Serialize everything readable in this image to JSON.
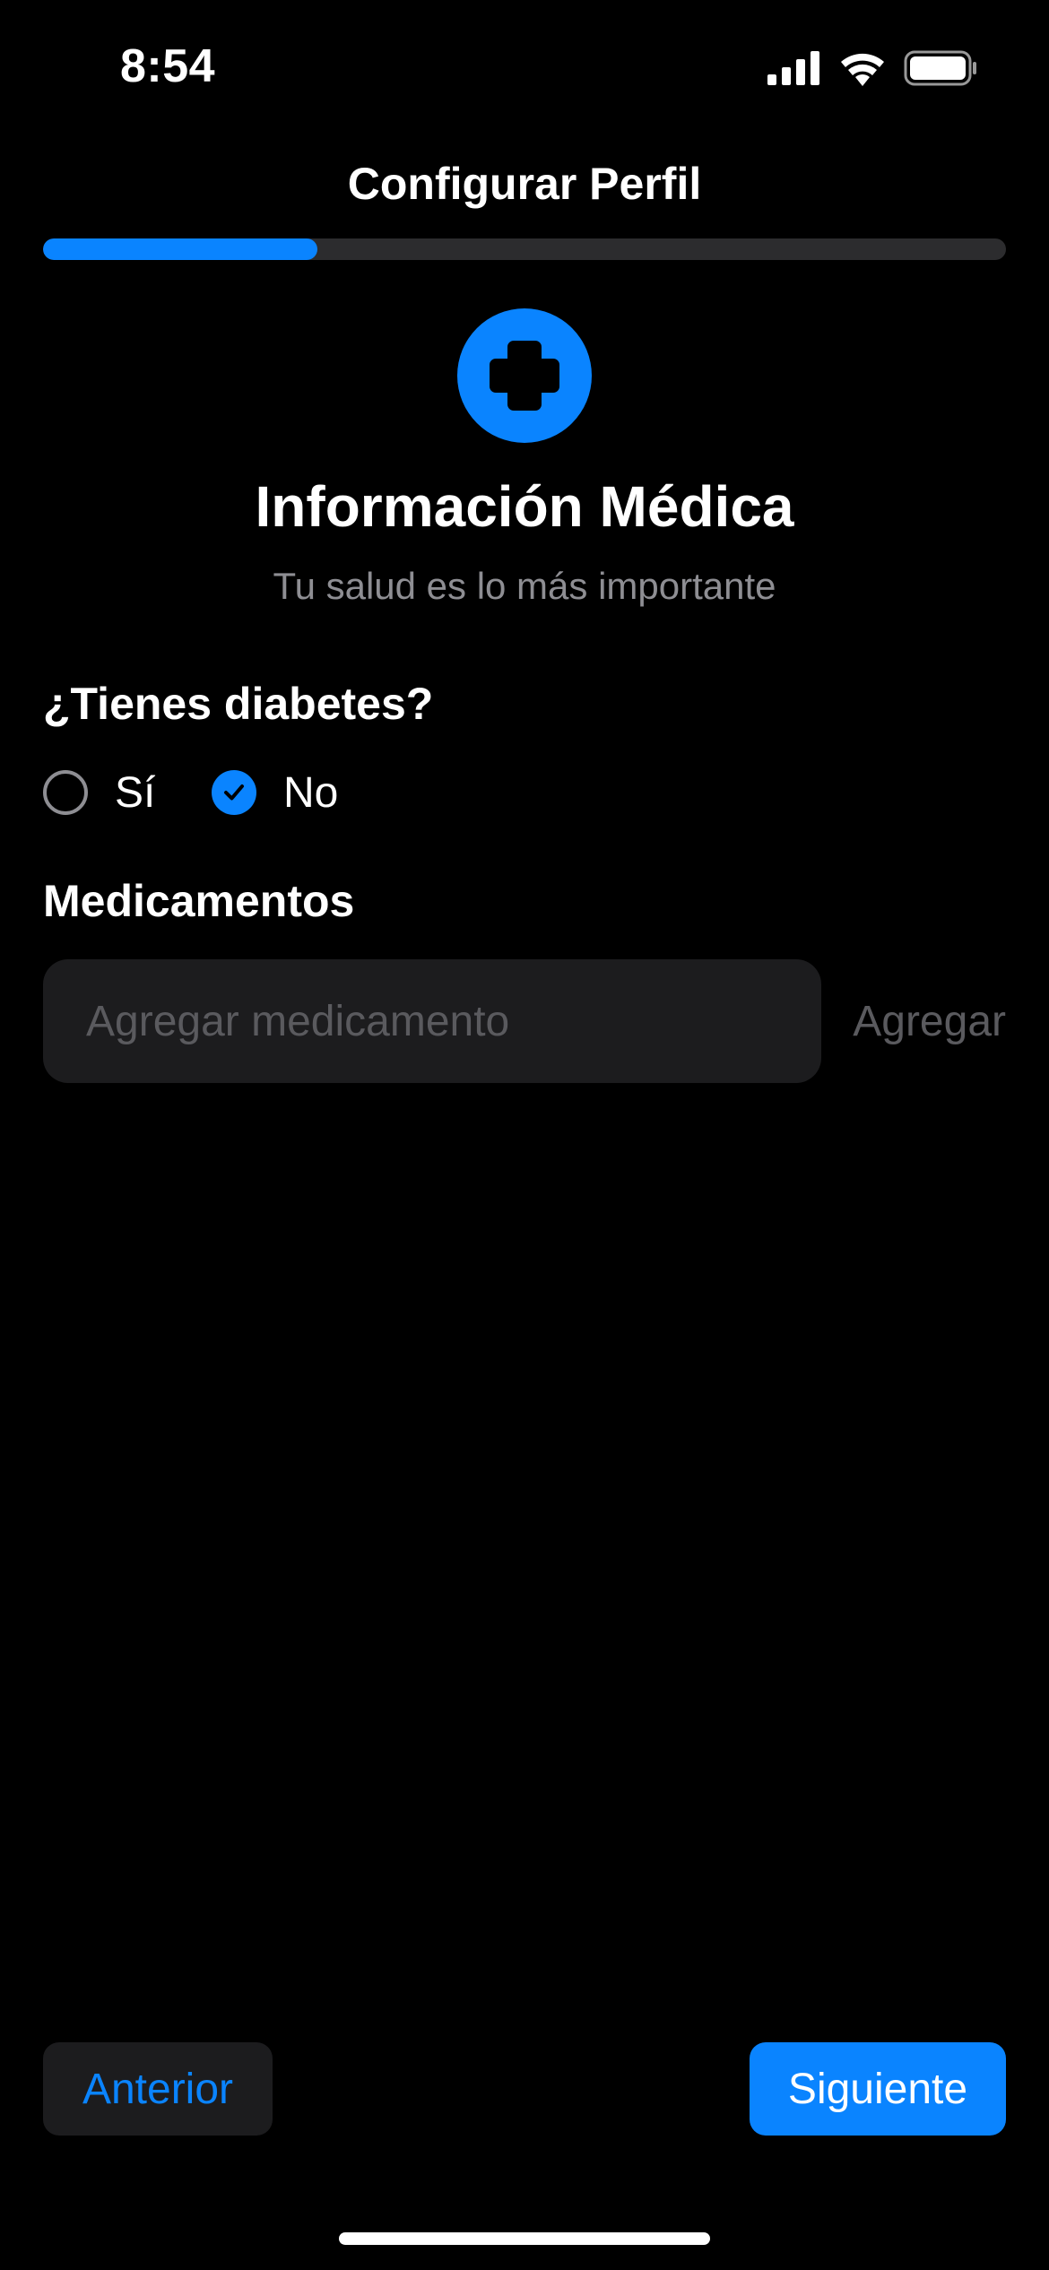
{
  "status_bar": {
    "time": "8:54",
    "icons": [
      "cellular-signal-icon",
      "wifi-icon",
      "battery-icon"
    ]
  },
  "nav": {
    "title": "Configurar Perfil"
  },
  "progress": {
    "fraction": 0.285,
    "fill_color": "#0a84ff",
    "track_color": "#2c2c2e"
  },
  "hero": {
    "icon": "medical-cross-icon",
    "title": "Información Médica",
    "subtitle": "Tu salud es lo más importante"
  },
  "diabetes_question": {
    "label": "¿Tienes diabetes?",
    "options": [
      {
        "label": "Sí",
        "selected": false
      },
      {
        "label": "No",
        "selected": true
      }
    ]
  },
  "medications": {
    "label": "Medicamentos",
    "input_placeholder": "Agregar medicamento",
    "input_value": "",
    "add_label": "Agregar"
  },
  "footer": {
    "previous_label": "Anterior",
    "next_label": "Siguiente"
  },
  "colors": {
    "accent": "#0a84ff",
    "background": "#000000",
    "secondary_text": "#8e8e93"
  }
}
